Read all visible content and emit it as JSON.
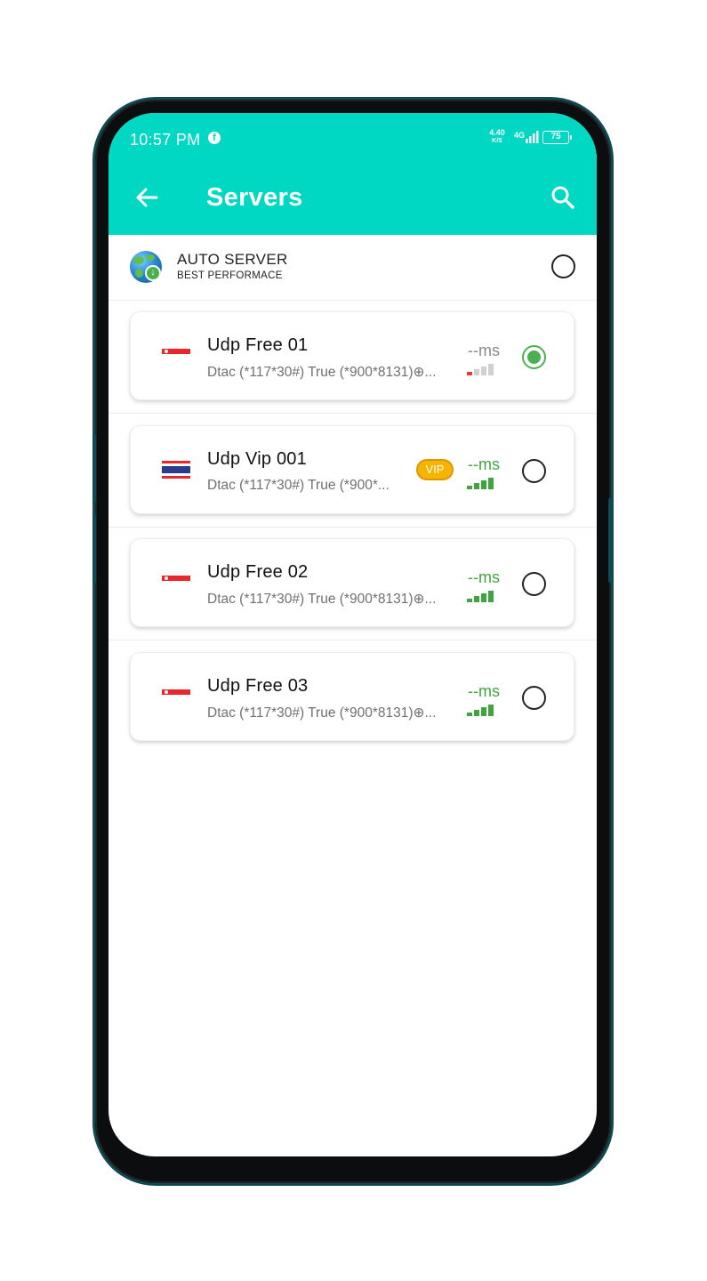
{
  "status_bar": {
    "time": "10:57 PM",
    "net_speed_value": "4.40",
    "net_speed_unit": "K/S",
    "network_type": "4G",
    "battery": "75"
  },
  "header": {
    "title": "Servers",
    "back_icon": "arrow-left-icon",
    "search_icon": "search-icon",
    "background": "#00d8c3"
  },
  "auto_server": {
    "title": "AUTO SERVER",
    "subtitle": "BEST PERFORMACE",
    "selected": false
  },
  "servers": [
    {
      "name": "Udp Free 01",
      "description": "Dtac (*117*30#) True (*900*8131)⊕...",
      "ping": "--ms",
      "flag": "singapore",
      "vip": false,
      "signal_level": 1,
      "selected": true
    },
    {
      "name": "Udp Vip 001",
      "description": "Dtac (*117*30#) True (*900*...",
      "ping": "--ms",
      "flag": "thailand",
      "vip": true,
      "vip_label": "VIP",
      "signal_level": 4,
      "selected": false
    },
    {
      "name": "Udp Free 02",
      "description": "Dtac (*117*30#) True (*900*8131)⊕...",
      "ping": "--ms",
      "flag": "singapore",
      "vip": false,
      "signal_level": 4,
      "selected": false
    },
    {
      "name": "Udp Free 03",
      "description": "Dtac (*117*30#) True (*900*8131)⊕...",
      "ping": "--ms",
      "flag": "singapore",
      "vip": false,
      "signal_level": 4,
      "selected": false
    }
  ],
  "colors": {
    "accent": "#00d8c3",
    "selected": "#4caf50",
    "signal_good": "#3fa53f",
    "signal_weak": "#e53935",
    "vip": "#f5b400"
  }
}
